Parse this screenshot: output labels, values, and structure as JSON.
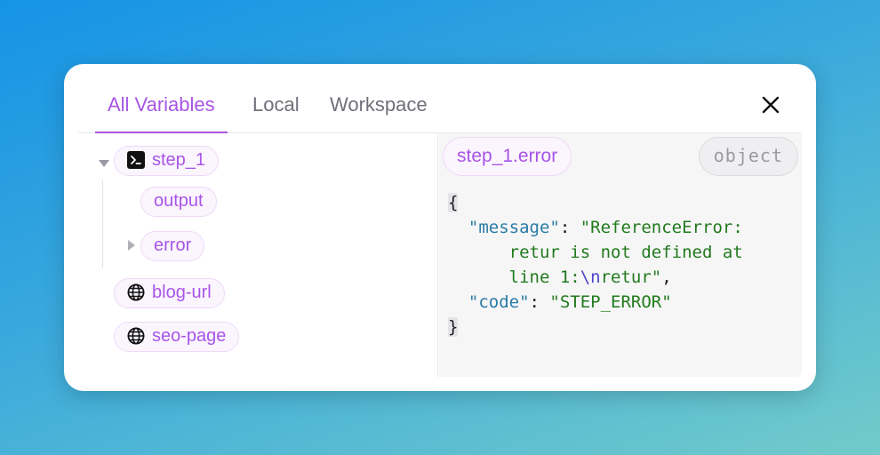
{
  "tabs": [
    {
      "label": "All Variables",
      "active": true
    },
    {
      "label": "Local",
      "active": false
    },
    {
      "label": "Workspace",
      "active": false
    }
  ],
  "tree": {
    "step": {
      "label": "step_1",
      "icon": "terminal-icon",
      "expanded": true
    },
    "children": [
      {
        "label": "output"
      },
      {
        "label": "error",
        "expandable": true
      }
    ],
    "globals": [
      {
        "label": "blog-url",
        "icon": "globe-icon"
      },
      {
        "label": "seo-page",
        "icon": "globe-icon"
      }
    ]
  },
  "inspector": {
    "path": "step_1.error",
    "type": "object",
    "json": {
      "open": "{",
      "close": "}",
      "message_key": "\"message\"",
      "message_val_1": "\"ReferenceError:",
      "message_val_2": "retur is not defined at",
      "message_val_3a": "line 1:",
      "message_val_3b": "\\n",
      "message_val_3c": "retur\"",
      "code_key": "\"code\"",
      "code_val": "\"STEP_ERROR\""
    }
  },
  "colors": {
    "accent": "#a855e6",
    "key": "#2a7aa5",
    "string": "#217a1c"
  }
}
